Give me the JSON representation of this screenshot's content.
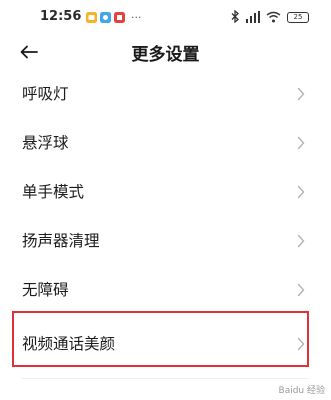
{
  "status_bar": {
    "time": "12:56",
    "notification_icons": [
      {
        "icon": "app-icon",
        "color": "#f5b428"
      },
      {
        "icon": "app-icon",
        "color": "#41a7e8"
      },
      {
        "icon": "app-icon",
        "color": "#e2433c"
      }
    ],
    "more": "···",
    "battery_level": "25"
  },
  "header": {
    "title": "更多设置",
    "back_icon": "arrow-left-icon"
  },
  "menu": {
    "items": [
      {
        "label": "呼吸灯"
      },
      {
        "label": "悬浮球"
      },
      {
        "label": "单手模式"
      },
      {
        "label": "扬声器清理"
      },
      {
        "label": "无障碍"
      },
      {
        "label": "视频通话美颜",
        "highlighted": true
      }
    ],
    "chevron_icon": "chevron-right-icon"
  },
  "highlight_color": "#e0303a",
  "watermark": "Baidu 经验"
}
